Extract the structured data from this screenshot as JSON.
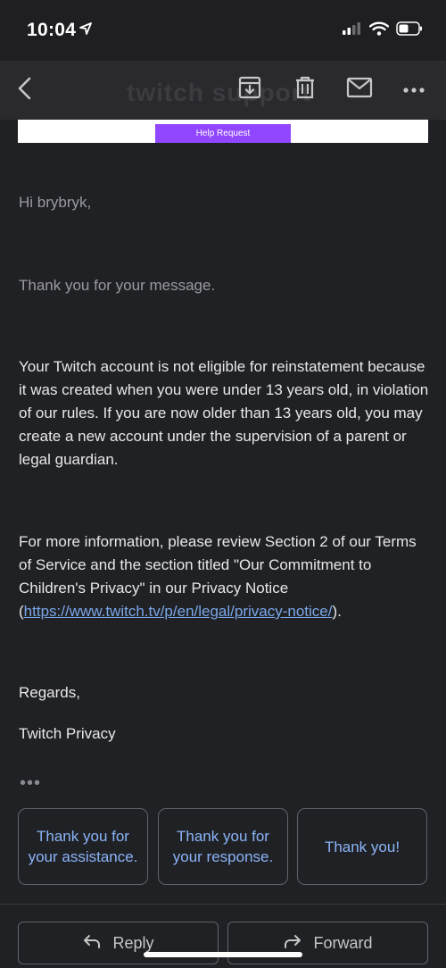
{
  "status_bar": {
    "time": "10:04",
    "icons": [
      "location-arrow-icon",
      "cellular-signal-icon",
      "wifi-icon",
      "battery-icon"
    ]
  },
  "toolbar": {
    "icons": [
      "back-chevron-icon",
      "archive-icon",
      "delete-icon",
      "mail-icon",
      "more-horizontal-icon"
    ],
    "ghost_text": "twitch support"
  },
  "email": {
    "header_button": "Help Request",
    "greeting": "Hi brybryk,",
    "thanks": "Thank you for your message.",
    "paragraph1": "Your Twitch account is not eligible for reinstatement because it was created when you were under 13 years old, in violation of our rules. If you are now older than 13 years old, you may create a new account under the supervision of a parent or legal guardian.",
    "paragraph2_text": "For more information, please review Section 2 of our Terms of Service and the section titled \"Our Commitment to Children's Privacy\" in our Privacy Notice (",
    "paragraph2_link": "https://www.twitch.tv/p/en/legal/privacy-notice/",
    "paragraph2_end": ").",
    "sign_off": "Regards,",
    "signature": "Twitch Privacy",
    "ellipsis": "•••"
  },
  "smart_replies": [
    "Thank you for your assistance.",
    "Thank you for your response.",
    "Thank you!"
  ],
  "actions": {
    "reply": "Reply",
    "forward": "Forward"
  },
  "colors": {
    "background": "#202124",
    "accent_purple": "#9147ff",
    "link_blue": "#7aa7e8",
    "smart_reply_text": "#8ab4f8"
  }
}
